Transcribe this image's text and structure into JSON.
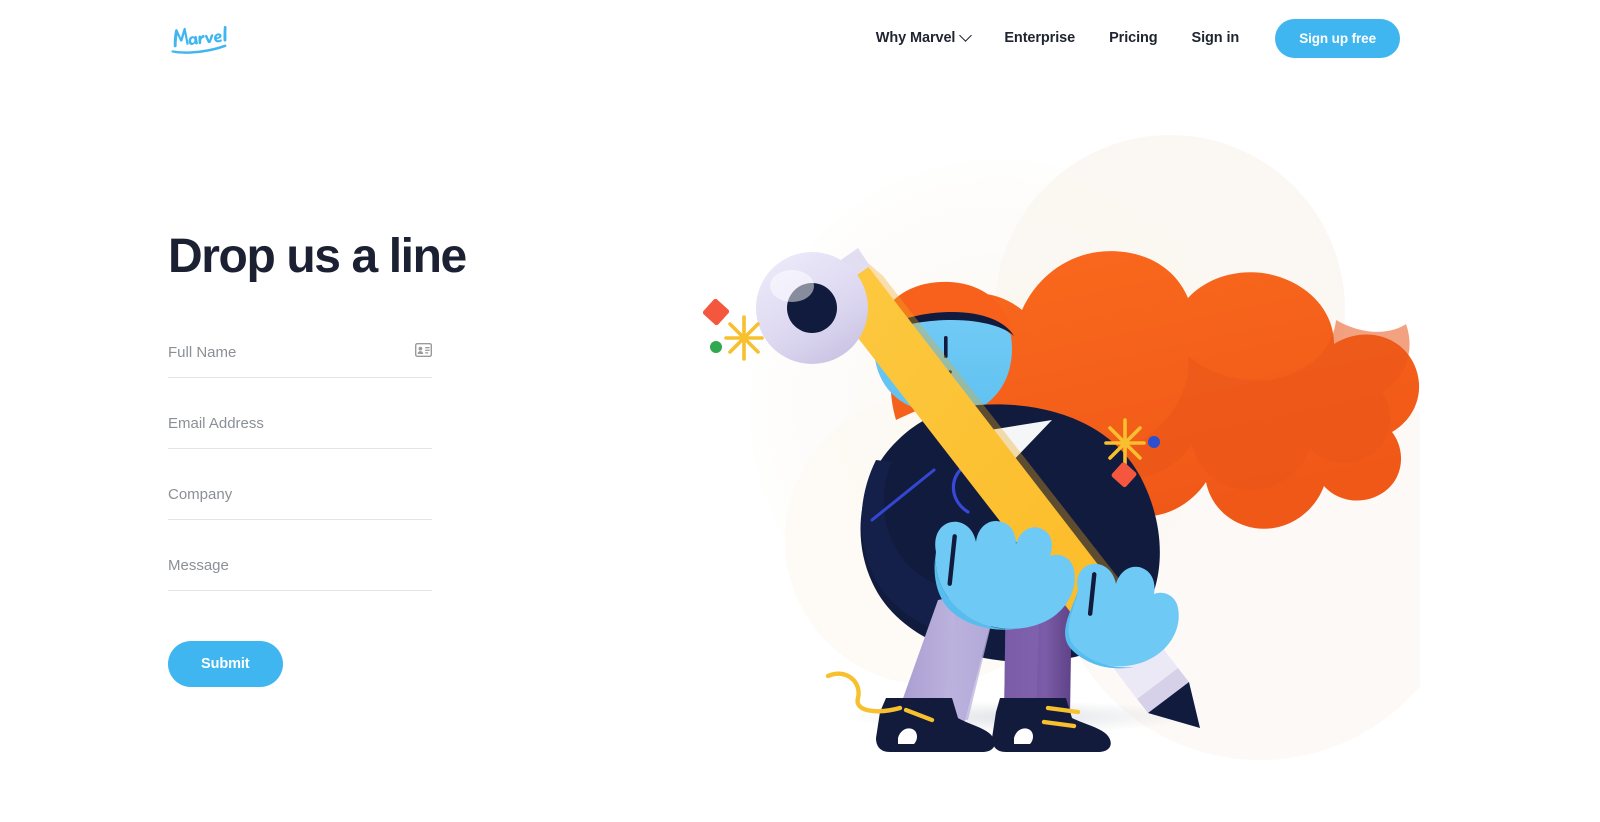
{
  "brand": {
    "name": "Marvel",
    "logo_icon": "marvel-script-logo",
    "accent_blue": "#3FB6F0",
    "text_dark": "#1B2133"
  },
  "header": {
    "nav": [
      {
        "label": "Why Marvel",
        "has_dropdown": true,
        "icon": "chevron-down-icon"
      },
      {
        "label": "Enterprise",
        "has_dropdown": false
      },
      {
        "label": "Pricing",
        "has_dropdown": false
      },
      {
        "label": "Sign in",
        "has_dropdown": false
      }
    ],
    "cta": {
      "label": "Sign up free",
      "color": "#3FB6F0"
    }
  },
  "main": {
    "title": "Drop us a line",
    "form": {
      "fields": [
        {
          "name": "full-name",
          "placeholder": "Full Name",
          "value": "",
          "icon": "contact-card-icon"
        },
        {
          "name": "email-address",
          "placeholder": "Email Address",
          "value": ""
        },
        {
          "name": "company",
          "placeholder": "Company",
          "value": ""
        },
        {
          "name": "message",
          "placeholder": "Message",
          "value": ""
        }
      ],
      "submit_label": "Submit"
    }
  },
  "illustration": {
    "name": "person-carrying-giant-pencil",
    "colors": {
      "hair_orange": "#F9661C",
      "hair_orange_shade": "#E8551A",
      "skin_blue": "#6FC9F5",
      "skin_blue_shade": "#57BDEE",
      "jacket_navy": "#111B3D",
      "jacket_navy_light": "#17244B",
      "pencil_yellow": "#FCBE2D",
      "pencil_yellow_shade": "#F0A81E",
      "eraser_lavender": "#DCD8F0",
      "trousers_purple": "#9F93C9",
      "trousers_purple_dark": "#6B4E96",
      "shoe_navy": "#121B3B",
      "lace_gold": "#F7C02E",
      "accent_red": "#F4573E",
      "accent_green": "#2FA84F",
      "accent_blue_dot": "#2B4FD1",
      "backdrop_warm": "#FAF6F1"
    },
    "decorations": [
      {
        "name": "red-diamond-left",
        "color": "#F4573E"
      },
      {
        "name": "green-dot-left",
        "color": "#2FA84F"
      },
      {
        "name": "yellow-sparkle-left",
        "color": "#F7C02E"
      },
      {
        "name": "yellow-sparkle-right",
        "color": "#F7C02E"
      },
      {
        "name": "blue-dot-right",
        "color": "#2B4FD1"
      },
      {
        "name": "red-diamond-right",
        "color": "#F4573E"
      }
    ]
  }
}
